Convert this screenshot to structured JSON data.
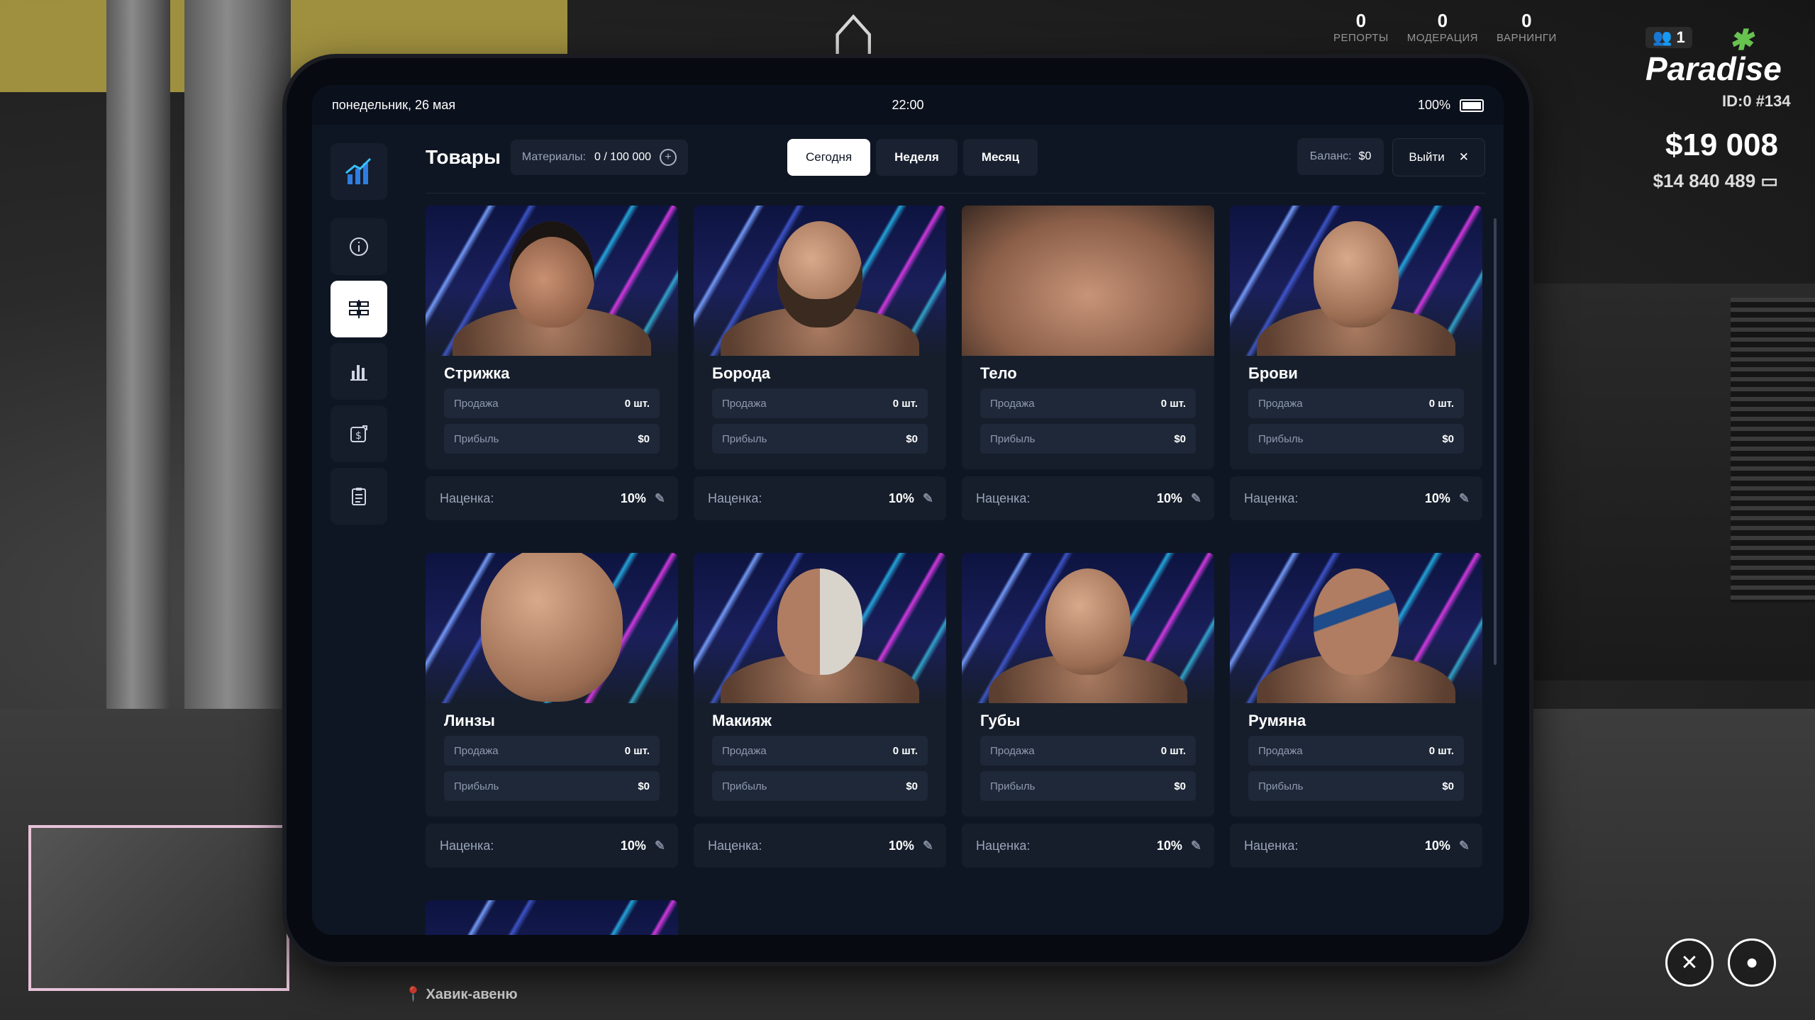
{
  "hud": {
    "counters": [
      {
        "value": "0",
        "label": "РЕПОРТЫ"
      },
      {
        "value": "0",
        "label": "МОДЕРАЦИЯ"
      },
      {
        "value": "0",
        "label": "ВАРНИНГИ"
      }
    ],
    "online": "1",
    "logo": "Paradise",
    "player_id": "ID:0 #134",
    "cash": "$19 008",
    "bank": "$14 840 489",
    "street": "Хавик-авеню"
  },
  "status_bar": {
    "date": "понедельник, 26 мая",
    "time": "22:00",
    "battery": "100%"
  },
  "header": {
    "title": "Товары",
    "materials_label": "Материалы:",
    "materials_value": "0 / 100 000",
    "periods": [
      "Сегодня",
      "Неделя",
      "Месяц"
    ],
    "active_period": "Сегодня",
    "balance_label": "Баланс:",
    "balance_value": "$0",
    "exit_label": "Выйти"
  },
  "sidebar": {
    "items": [
      {
        "icon": "info-icon"
      },
      {
        "icon": "products-icon",
        "active": true
      },
      {
        "icon": "stats-icon"
      },
      {
        "icon": "finance-icon"
      },
      {
        "icon": "clipboard-icon"
      }
    ]
  },
  "labels": {
    "sale": "Продажа",
    "profit": "Прибыль",
    "markup": "Наценка:"
  },
  "products": [
    {
      "name": "Стрижка",
      "sale": "0 шт.",
      "profit": "$0",
      "markup": "10%"
    },
    {
      "name": "Борода",
      "sale": "0 шт.",
      "profit": "$0",
      "markup": "10%"
    },
    {
      "name": "Тело",
      "sale": "0 шт.",
      "profit": "$0",
      "markup": "10%"
    },
    {
      "name": "Брови",
      "sale": "0 шт.",
      "profit": "$0",
      "markup": "10%"
    },
    {
      "name": "Линзы",
      "sale": "0 шт.",
      "profit": "$0",
      "markup": "10%"
    },
    {
      "name": "Макияж",
      "sale": "0 шт.",
      "profit": "$0",
      "markup": "10%"
    },
    {
      "name": "Губы",
      "sale": "0 шт.",
      "profit": "$0",
      "markup": "10%"
    },
    {
      "name": "Румяна",
      "sale": "0 шт.",
      "profit": "$0",
      "markup": "10%"
    }
  ],
  "colors": {
    "panel_bg": "#0f1623",
    "card_bg": "#161e2c",
    "accent_active": "#ffffff"
  }
}
